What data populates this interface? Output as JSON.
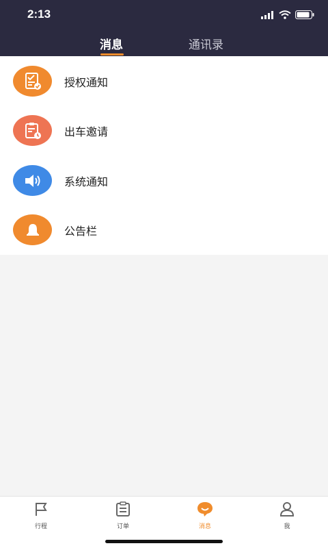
{
  "status": {
    "time": "2:13"
  },
  "tabs": [
    {
      "label": "消息",
      "active": true
    },
    {
      "label": "通讯录",
      "active": false
    }
  ],
  "items": [
    {
      "label": "授权通知",
      "icon": "authorization-notice-icon",
      "color": "#f08a2e"
    },
    {
      "label": "出车邀请",
      "icon": "car-invite-icon",
      "color": "#ee7453"
    },
    {
      "label": "系统通知",
      "icon": "speaker-icon",
      "color": "#3f8ae6"
    },
    {
      "label": "公告栏",
      "icon": "bell-icon",
      "color": "#f08a2e"
    }
  ],
  "tabbar": [
    {
      "label": "行程",
      "icon": "flag-icon",
      "active": false
    },
    {
      "label": "订单",
      "icon": "clipboard-icon",
      "active": false
    },
    {
      "label": "消息",
      "icon": "message-icon",
      "active": true
    },
    {
      "label": "我",
      "icon": "user-icon",
      "active": false
    }
  ],
  "colors": {
    "header_bg": "#2b2a40",
    "accent": "#f08c2c"
  }
}
